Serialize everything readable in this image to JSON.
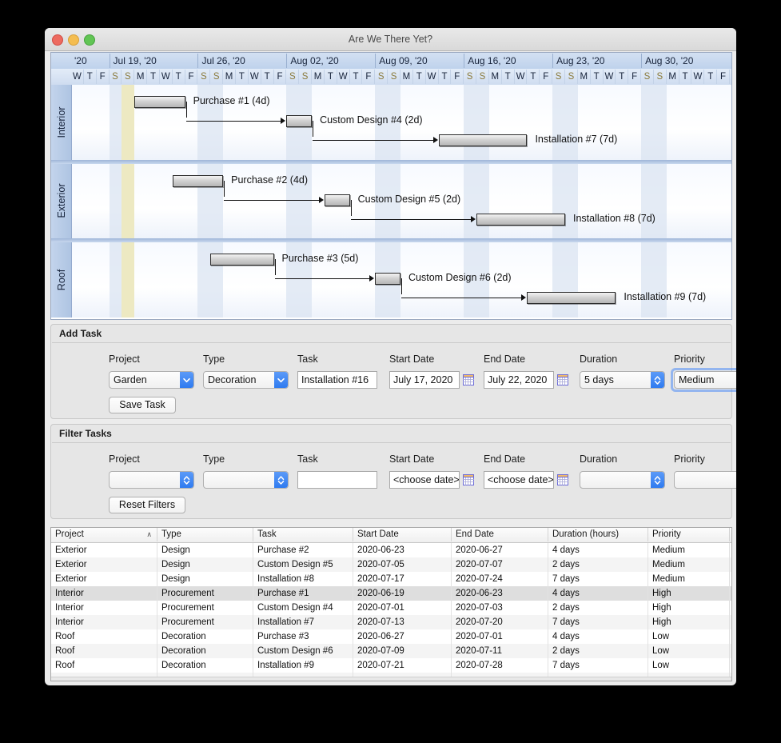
{
  "window": {
    "title": "Are We There Yet?",
    "controls": [
      "close-button",
      "minimize-button",
      "zoom-button"
    ]
  },
  "gantt": {
    "week_labels": [
      "'20",
      "Jul 19, '20",
      "Jul 26, '20",
      "Aug 02, '20",
      "Aug 09, '20",
      "Aug 16, '20",
      "Aug 23, '20",
      "Aug 30, '20"
    ],
    "day_labels": [
      "W",
      "T",
      "F",
      "S",
      "S",
      "M",
      "T",
      "W",
      "T",
      "F",
      "S",
      "S",
      "M",
      "T",
      "W",
      "T",
      "F",
      "S",
      "S",
      "M",
      "T",
      "W",
      "T",
      "F",
      "S",
      "S",
      "M",
      "T",
      "W",
      "T",
      "F",
      "S",
      "S",
      "M",
      "T",
      "W",
      "T",
      "F",
      "S",
      "S",
      "M",
      "T",
      "W",
      "T",
      "F",
      "S",
      "S",
      "M",
      "T",
      "W",
      "T",
      "F"
    ],
    "rows": [
      {
        "label": "Interior",
        "bars": [
          {
            "label": "Purchase #1 (4d)",
            "start_index": 5,
            "days": 4,
            "lane": 0
          },
          {
            "label": "Custom Design #4 (2d)",
            "start_index": 17,
            "days": 2,
            "lane": 1
          },
          {
            "label": "Installation #7 (7d)",
            "start_index": 29,
            "days": 7,
            "lane": 2
          }
        ]
      },
      {
        "label": "Exterior",
        "bars": [
          {
            "label": "Purchase #2 (4d)",
            "start_index": 8,
            "days": 4,
            "lane": 0
          },
          {
            "label": "Custom Design #5 (2d)",
            "start_index": 20,
            "days": 2,
            "lane": 1
          },
          {
            "label": "Installation #8 (7d)",
            "start_index": 32,
            "days": 7,
            "lane": 2
          }
        ]
      },
      {
        "label": "Roof",
        "bars": [
          {
            "label": "Purchase #3 (5d)",
            "start_index": 11,
            "days": 5,
            "lane": 0
          },
          {
            "label": "Custom Design #6 (2d)",
            "start_index": 24,
            "days": 2,
            "lane": 1
          },
          {
            "label": "Installation #9 (7d)",
            "start_index": 36,
            "days": 7,
            "lane": 2
          }
        ]
      }
    ]
  },
  "add_task": {
    "title": "Add Task",
    "labels": {
      "project": "Project",
      "type": "Type",
      "task": "Task",
      "start_date": "Start Date",
      "end_date": "End Date",
      "duration": "Duration",
      "priority": "Priority"
    },
    "values": {
      "project": "Garden",
      "type": "Decoration",
      "task": "Installation #16",
      "start_date": "July 17, 2020",
      "end_date": "July 22, 2020",
      "duration": "5 days",
      "priority": "Medium"
    },
    "save_label": "Save Task",
    "focused_field": "priority"
  },
  "filter_tasks": {
    "title": "Filter Tasks",
    "labels": {
      "project": "Project",
      "type": "Type",
      "task": "Task",
      "start_date": "Start Date",
      "end_date": "End Date",
      "duration": "Duration",
      "priority": "Priority"
    },
    "values": {
      "project": "",
      "type": "",
      "task": "",
      "start_date": "<choose date>",
      "end_date": "<choose date>",
      "duration": "",
      "priority": ""
    },
    "reset_label": "Reset Filters"
  },
  "table": {
    "columns": [
      "Project",
      "Type",
      "Task",
      "Start Date",
      "End Date",
      "Duration (hours)",
      "Priority"
    ],
    "sorted_column": "Project",
    "sort_caret": "∧",
    "selected_row_index": 3,
    "rows": [
      [
        "Exterior",
        "Design",
        "Purchase #2",
        "2020-06-23",
        "2020-06-27",
        "4 days",
        "Medium"
      ],
      [
        "Exterior",
        "Design",
        "Custom Design #5",
        "2020-07-05",
        "2020-07-07",
        "2 days",
        "Medium"
      ],
      [
        "Exterior",
        "Design",
        "Installation #8",
        "2020-07-17",
        "2020-07-24",
        "7 days",
        "Medium"
      ],
      [
        "Interior",
        "Procurement",
        "Purchase #1",
        "2020-06-19",
        "2020-06-23",
        "4 days",
        "High"
      ],
      [
        "Interior",
        "Procurement",
        "Custom Design #4",
        "2020-07-01",
        "2020-07-03",
        "2 days",
        "High"
      ],
      [
        "Interior",
        "Procurement",
        "Installation #7",
        "2020-07-13",
        "2020-07-20",
        "7 days",
        "High"
      ],
      [
        "Roof",
        "Decoration",
        "Purchase #3",
        "2020-06-27",
        "2020-07-01",
        "4 days",
        "Low"
      ],
      [
        "Roof",
        "Decoration",
        "Custom Design #6",
        "2020-07-09",
        "2020-07-11",
        "2 days",
        "Low"
      ],
      [
        "Roof",
        "Decoration",
        "Installation #9",
        "2020-07-21",
        "2020-07-28",
        "7 days",
        "Low"
      ],
      [
        "",
        "",
        "",
        "",
        "",
        "",
        ""
      ],
      [
        "",
        "",
        "",
        "",
        "",
        "",
        ""
      ]
    ]
  },
  "colors": {
    "accent": "#2f7bf0",
    "gantt_header": "#bfd2ec",
    "today_column": "#efe9b8",
    "weekend_column": "#dbe4f2",
    "selected_row": "#dedede"
  }
}
